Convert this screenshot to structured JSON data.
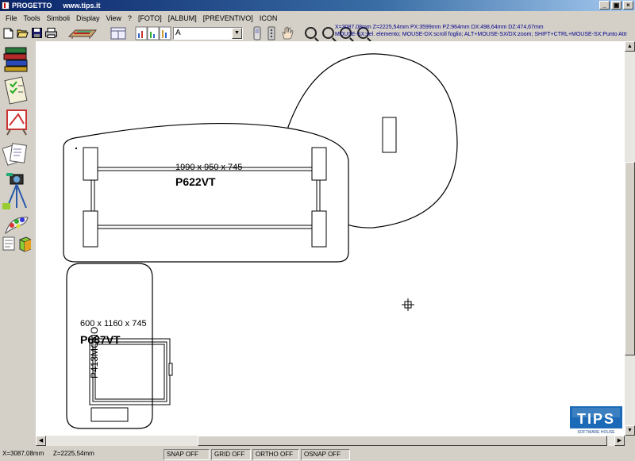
{
  "window": {
    "title": "PROGETTO",
    "url": "www.tips.it",
    "buttons": {
      "minimize": "_",
      "maximize": "▣",
      "close": "×"
    }
  },
  "menu": [
    "File",
    "Tools",
    "Simboli",
    "Display",
    "View",
    "?",
    "[FOTO]",
    "[ALBUM]",
    "[PREVENTIVO]",
    "ICON"
  ],
  "toolbar": {
    "font_value": "A",
    "info_line1": "X=3087,08mm   Z=2225,54mm   PX:3599mm PZ:964mm   DX:498,64mm DZ:474,67mm",
    "info_line2": "MOUSE-SX:sel. elemento; MOUSE-DX:scroll foglio; ALT+MOUSE-SX/DX:zoom; SHIFT+CTRL+MOUSE-SX:Punto Attr"
  },
  "drawing": {
    "desk_main": {
      "dims": "1990 x 950 x 745",
      "code": "P622VT"
    },
    "desk_side": {
      "dims": "600 x 1160 x 745",
      "code": "P687VT"
    },
    "drawer_unit": {
      "code": "P413MONO"
    }
  },
  "logo": {
    "text": "TIPS",
    "subtitle": "SOFTWARE HOUSE"
  },
  "status": {
    "x": "X=3087,08mm",
    "z": "Z=2225,54mm",
    "snap": "SNAP OFF",
    "grid": "GRID OFF",
    "ortho": "ORTHO OFF",
    "osnap": "OSNAP OFF"
  }
}
